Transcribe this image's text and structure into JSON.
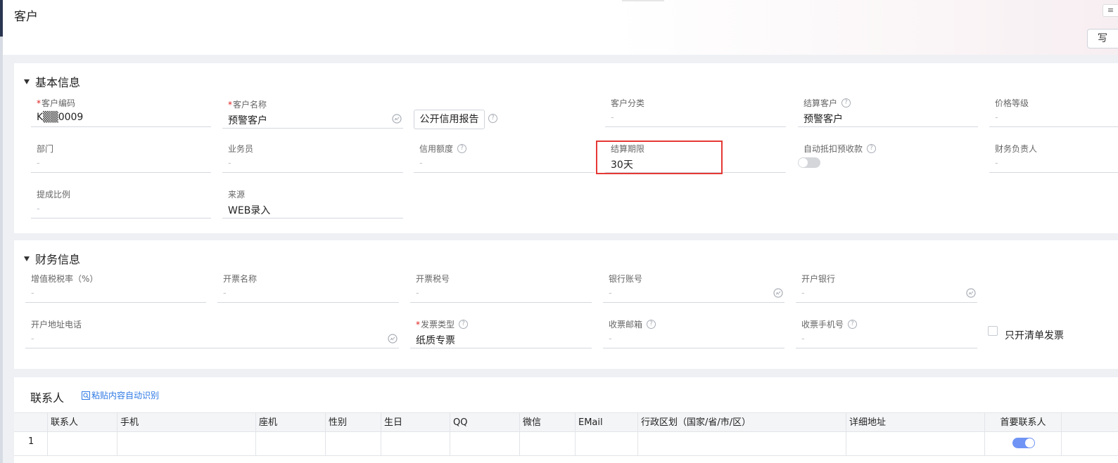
{
  "page": {
    "title": "客户",
    "write_button": "写",
    "corner_button": "≡"
  },
  "basic": {
    "section_title": "基本信息",
    "customer_code": {
      "label": "客户编码",
      "value": "K▒▒0009"
    },
    "customer_name": {
      "label": "客户名称",
      "value": "预警客户"
    },
    "credit_report_button": "公开信用报告",
    "customer_category": {
      "label": "客户分类",
      "value": "-"
    },
    "settlement_customer": {
      "label": "结算客户",
      "value": "预警客户"
    },
    "price_level": {
      "label": "价格等级",
      "value": "-"
    },
    "department": {
      "label": "部门",
      "value": "-"
    },
    "salesperson": {
      "label": "业务员",
      "value": "-"
    },
    "credit_limit": {
      "label": "信用额度",
      "value": "-"
    },
    "settlement_term": {
      "label": "结算期限",
      "value": "30天"
    },
    "auto_offset": {
      "label": "自动抵扣预收款",
      "enabled": false
    },
    "finance_owner": {
      "label": "财务负责人",
      "value": "-"
    },
    "commission_ratio": {
      "label": "提成比例",
      "value": "-"
    },
    "source": {
      "label": "来源",
      "value": "WEB录入"
    }
  },
  "finance": {
    "section_title": "财务信息",
    "vat_rate": {
      "label": "增值税税率（%）",
      "value": "-"
    },
    "invoice_name": {
      "label": "开票名称",
      "value": "-"
    },
    "tax_number": {
      "label": "开票税号",
      "value": "-"
    },
    "bank_account": {
      "label": "银行账号",
      "value": "-"
    },
    "bank": {
      "label": "开户银行",
      "value": "-"
    },
    "address_phone": {
      "label": "开户地址电话",
      "value": "-"
    },
    "invoice_type": {
      "label": "发票类型",
      "value": "纸质专票"
    },
    "email": {
      "label": "收票邮箱",
      "value": "-"
    },
    "mobile": {
      "label": "收票手机号",
      "value": "-"
    },
    "only_list_invoice": {
      "label": "只开清单发票",
      "checked": false
    }
  },
  "contacts": {
    "title": "联系人",
    "paste_link": "粘贴内容自动识别",
    "columns": [
      "联系人",
      "手机",
      "座机",
      "性别",
      "生日",
      "QQ",
      "微信",
      "EMail",
      "行政区划（国家/省/市/区）",
      "详细地址",
      "首要联系人"
    ],
    "rows": [
      {
        "index": "1",
        "primary": true
      }
    ]
  },
  "icon_color": "#a8adb5",
  "highlight_color": "#e53935",
  "link_color": "#2f7ae5"
}
